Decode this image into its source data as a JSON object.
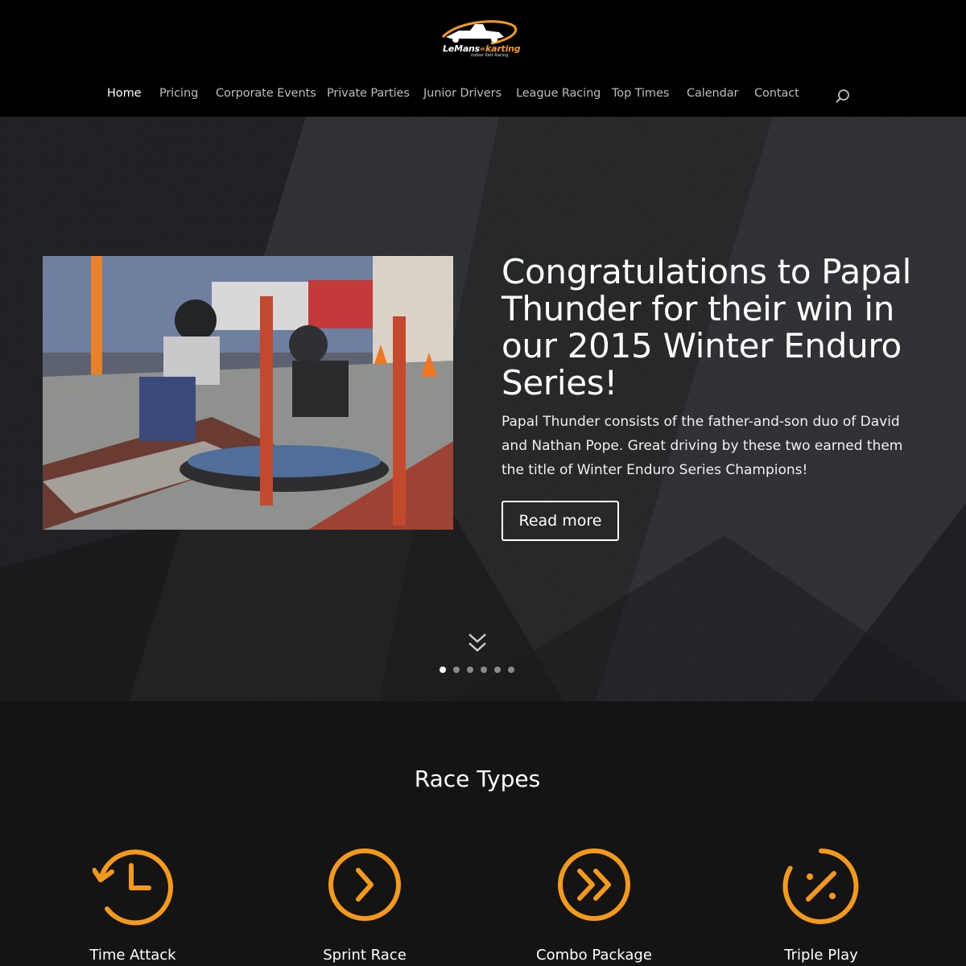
{
  "header": {
    "logo": {
      "brand_white": "LeMans",
      "brand_orange": "karting",
      "subtitle": "Indoor Kart Racing"
    },
    "nav": [
      {
        "label": "Home",
        "active": true
      },
      {
        "label": "Pricing"
      },
      {
        "label": "Corporate Events"
      },
      {
        "label": "Private Parties"
      },
      {
        "label": "Junior Drivers"
      },
      {
        "label": "League Racing"
      },
      {
        "label": "Top Times"
      },
      {
        "label": "Calendar"
      },
      {
        "label": "Contact"
      }
    ],
    "search_icon": "search-icon"
  },
  "hero": {
    "title": "Congratulations to Papal Thunder for their win in our 2015 Winter Enduro Series!",
    "body": "Papal Thunder consists of the father-and-son duo of David and Nathan Pope. Great driving by these two earned them the title of Winter Enduro Series Champions!",
    "button": "Read more",
    "slide_count": 6,
    "active_slide": 1
  },
  "race_types": {
    "title": "Race Types",
    "items": [
      {
        "label": "Time Attack",
        "icon": "history-clock-icon"
      },
      {
        "label": "Sprint Race",
        "icon": "chevron-right-circle-icon"
      },
      {
        "label": "Combo Package",
        "icon": "double-chevron-right-circle-icon"
      },
      {
        "label": "Triple Play",
        "icon": "percent-circle-icon"
      }
    ]
  },
  "colors": {
    "accent": "#f39a1c",
    "header_bg": "#000000",
    "section_bg": "#141414"
  }
}
